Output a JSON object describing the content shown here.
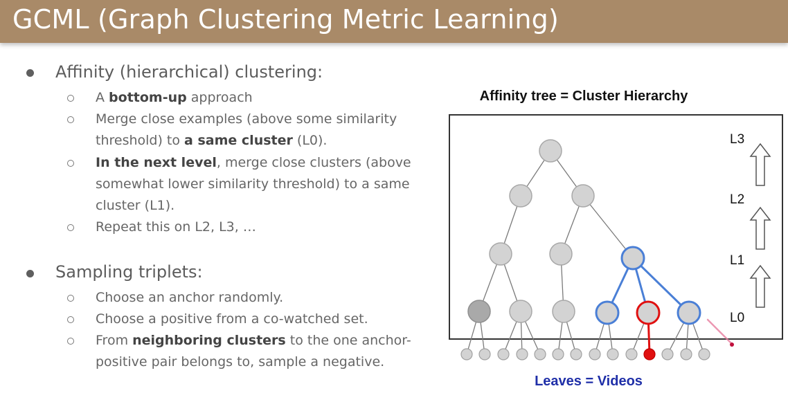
{
  "slide": {
    "title": "GCML (Graph Clustering Metric Learning)"
  },
  "bullets": {
    "affinity": {
      "heading": "Affinity (hierarchical) clustering:",
      "items": [
        {
          "pre": "A ",
          "bold": "bottom-up",
          "post": " approach"
        },
        {
          "pre": "Merge close examples (above some similarity threshold) to ",
          "bold": "a same cluster",
          "post": " (L0)."
        },
        {
          "pre": "",
          "bold": "In the next level",
          "post": ", merge close clusters (above somewhat lower similarity threshold) to a same cluster (L1)."
        },
        {
          "pre": "Repeat this on L2, L3, …",
          "bold": "",
          "post": ""
        }
      ]
    },
    "sampling": {
      "heading": "Sampling triplets:",
      "items": [
        {
          "pre": "Choose an anchor randomly.",
          "bold": "",
          "post": ""
        },
        {
          "pre": "Choose a positive from a co-watched set.",
          "bold": "",
          "post": ""
        },
        {
          "pre": "From ",
          "bold": "neighboring clusters",
          "post": " to the one anchor-positive pair belongs to, sample a negative."
        }
      ]
    }
  },
  "diagram": {
    "title": "Affinity tree = Cluster Hierarchy",
    "caption": "Leaves = Videos",
    "levels": [
      "L3",
      "L2",
      "L1",
      "L0"
    ],
    "colors": {
      "node_fill": "#d3d3d3",
      "node_stroke": "#a8a8a8",
      "anchor_fill": "#a9a9a9",
      "highlight_blue": "#4a7fd6",
      "highlight_red": "#e01010",
      "edge": "#777777",
      "caption": "#1f2fa8"
    }
  }
}
